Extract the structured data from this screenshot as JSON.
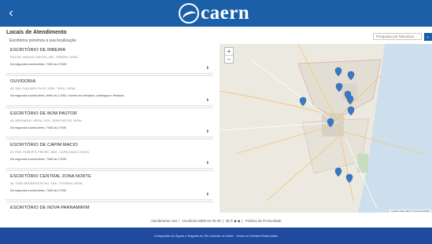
{
  "header": {
    "back_label": "‹",
    "logo_text": "caern",
    "logo_subtitle": ""
  },
  "page": {
    "title": "Locais de Atendimento",
    "subtitle": "Escritórios próximos à sua localização",
    "search_placeholder": "Pesquisar por Município",
    "search_button_label": "⌄"
  },
  "locations": [
    {
      "title": "ESCRITÓRIO DE RIBEIRA",
      "address": "RUA DR. MANUEL DANTAS, 690 - RIBEIRA, NATAL",
      "hours": "De segunda a sexta-feira, 7h30 às 17h30"
    },
    {
      "title": "OUVIDORIA",
      "address": "AV. SEN. SALGADO FILHO, 1555 - TIROL, NATAL",
      "hours": "De segunda a sexta-feira, 8h00 às 17h00, exceto nos feriados, domingos e feriados"
    },
    {
      "title": "ESCRITÓRIO DE BOM PASTOR",
      "address": "AV. BERNARDO VIEIRA, 3200 - BOM PASTOR, NATAL",
      "hours": "De segunda a sexta-feira, 7h30 às 17h30"
    },
    {
      "title": "ESCRITÓRIO DE CAPIM MACIO",
      "address": "AV. ENG. ROBERTO FREIRE, 2684 - CAPIM MACIO, NATAL",
      "hours": "De segunda a sexta-feira, 7h30 às 17h30"
    },
    {
      "title": "ESCRITÓRIO CENTRAL ZONA NORTE",
      "address": "AV. JOÃO MEDEIROS FILHO, 1400 - POTENGI, NATAL",
      "hours": "De segunda a sexta-feira, 7h30 às 17h30"
    },
    {
      "title": "ESCRITÓRIO DE NOVA PARNAMIRIM",
      "address": "",
      "hours": ""
    }
  ],
  "map": {
    "zoom_in": "+",
    "zoom_out": "−",
    "attribution": "Leaflet | Map data © OpenStreetMap"
  },
  "footer": {
    "attendance": "Atendimento 115",
    "ombudsman": "Ouvidoria 0800 81 00 00",
    "social_icons": "⊞ ✆ ◆ ◆",
    "privacy": "Política de Privacidade"
  },
  "bottom_bar": {
    "text": "Companhia de Águas e Esgotos do Rio Grande do Norte - Todos os Direitos Reservados"
  },
  "colors": {
    "header_bg": "#1a5fa8",
    "bottom_bg": "#1f4aa0",
    "marker": "#3b78c4"
  }
}
